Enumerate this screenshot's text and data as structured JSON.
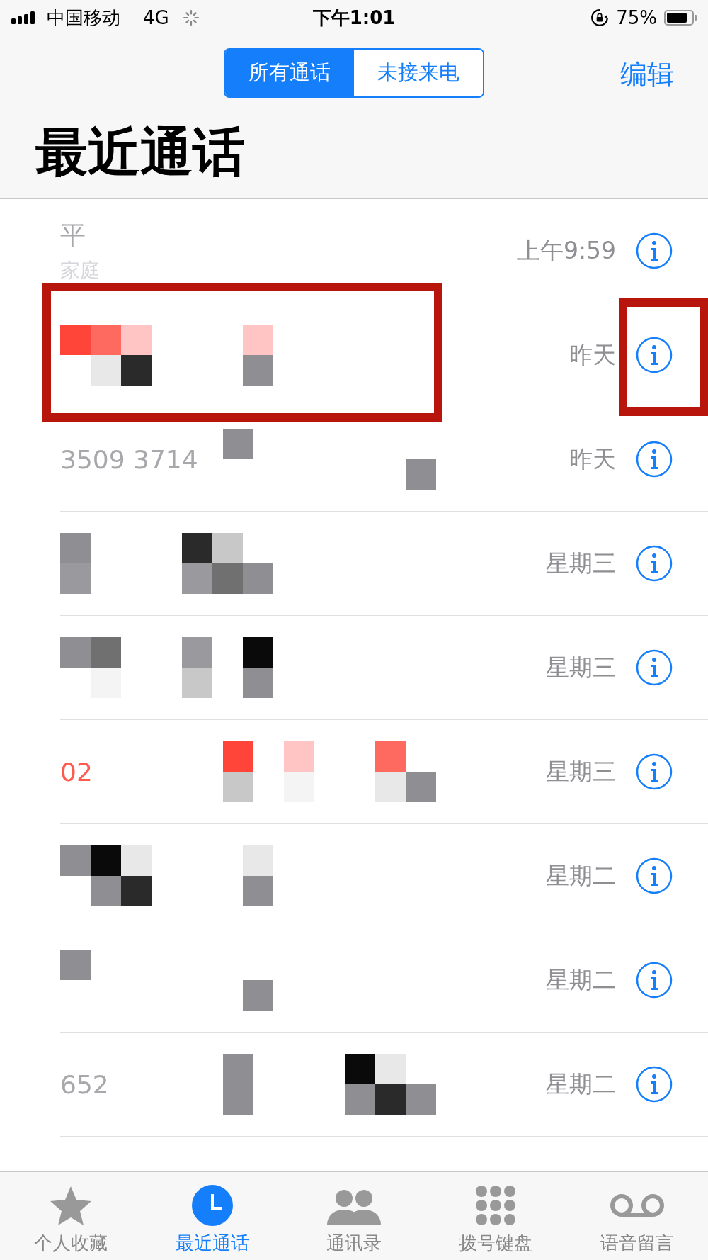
{
  "status_bar": {
    "carrier": "中国移动",
    "network": "4G",
    "time": "下午1:01",
    "battery": "75%"
  },
  "segments": [
    {
      "label": "所有通话",
      "selected": true
    },
    {
      "label": "未接来电",
      "selected": false
    }
  ],
  "edit": "编辑",
  "title": "最近通话",
  "calls": [
    {
      "name": "平",
      "label": "家庭",
      "time": "上午9:59",
      "missed": false
    },
    {
      "time": "昨天",
      "missed": true
    },
    {
      "name": "3509 3714",
      "time": "昨天",
      "missed": false
    },
    {
      "time": "星期三",
      "missed": false
    },
    {
      "time": "星期三",
      "missed": false
    },
    {
      "name": "02",
      "time": "星期三",
      "missed": true
    },
    {
      "time": "星期二",
      "missed": false
    },
    {
      "time": "星期二",
      "missed": false
    },
    {
      "name": "652",
      "time": "星期二",
      "missed": false
    }
  ],
  "tabs": [
    {
      "label": "个人收藏",
      "selected": false,
      "kind": "star"
    },
    {
      "label": "最近通话",
      "selected": true,
      "kind": "clock"
    },
    {
      "label": "通讯录",
      "selected": false,
      "kind": "people"
    },
    {
      "label": "拨号键盘",
      "selected": false,
      "kind": "keypad"
    },
    {
      "label": "语音留言",
      "selected": false,
      "kind": "voicemail"
    }
  ]
}
